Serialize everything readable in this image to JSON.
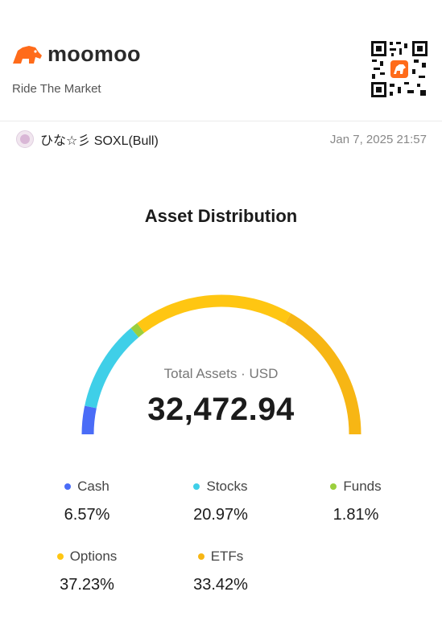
{
  "brand": {
    "name": "moomoo",
    "tagline": "Ride The Market",
    "color": "#FF6B1A"
  },
  "user": {
    "name": "ひな☆彡 SOXL(Bull)",
    "timestamp": "Jan 7, 2025 21:57"
  },
  "title": "Asset Distribution",
  "summary": {
    "label": "Total Assets · USD",
    "value": "32,472.94"
  },
  "legend": [
    {
      "label": "Cash",
      "percent": "6.57%",
      "color": "#4A6CF7"
    },
    {
      "label": "Stocks",
      "percent": "20.97%",
      "color": "#3FCFE8"
    },
    {
      "label": "Funds",
      "percent": "1.81%",
      "color": "#9BCF3D"
    },
    {
      "label": "Options",
      "percent": "37.23%",
      "color": "#FFC612"
    },
    {
      "label": "ETFs",
      "percent": "33.42%",
      "color": "#F7B614"
    }
  ],
  "chart_data": {
    "type": "gauge",
    "categories": [
      "Cash",
      "Stocks",
      "Funds",
      "Options",
      "ETFs"
    ],
    "values": [
      6.57,
      20.97,
      1.81,
      37.23,
      33.42
    ],
    "colors": [
      "#4A6CF7",
      "#3FCFE8",
      "#9BCF3D",
      "#FFC612",
      "#F7B614"
    ],
    "title": "Asset Distribution"
  }
}
